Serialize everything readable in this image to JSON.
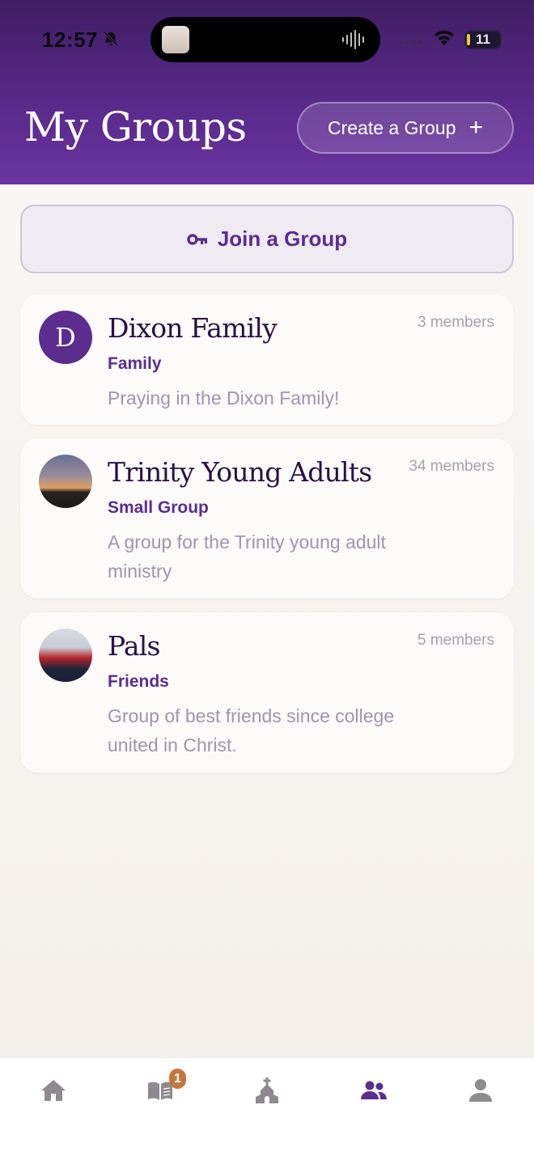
{
  "status_bar": {
    "time": "12:57",
    "battery": "11"
  },
  "header": {
    "title": "My Groups",
    "create_label": "Create a Group",
    "create_icon": "plus-icon"
  },
  "join": {
    "label": "Join a Group",
    "icon": "key-icon"
  },
  "groups": [
    {
      "name": "Dixon Family",
      "type": "Family",
      "members": "3 members",
      "description": "Praying in the Dixon Family!",
      "avatar_letter": "D"
    },
    {
      "name": "Trinity Young Adults",
      "type": "Small Group",
      "members": "34 members",
      "description": "A group for the Trinity young adult ministry"
    },
    {
      "name": "Pals",
      "type": "Friends",
      "members": "5 members",
      "description": "Group of best friends since college united in Christ."
    }
  ],
  "tabbar": {
    "items": [
      {
        "icon": "home-icon"
      },
      {
        "icon": "book-icon",
        "badge": "1"
      },
      {
        "icon": "church-icon"
      },
      {
        "icon": "groups-icon",
        "active": true
      },
      {
        "icon": "profile-icon"
      }
    ]
  },
  "colors": {
    "accent": "#5b2d8f",
    "header_top": "#3f1d63",
    "header_bottom": "#6a34a0",
    "badge": "#c4783f",
    "inactive_icon": "#8e8a90"
  }
}
